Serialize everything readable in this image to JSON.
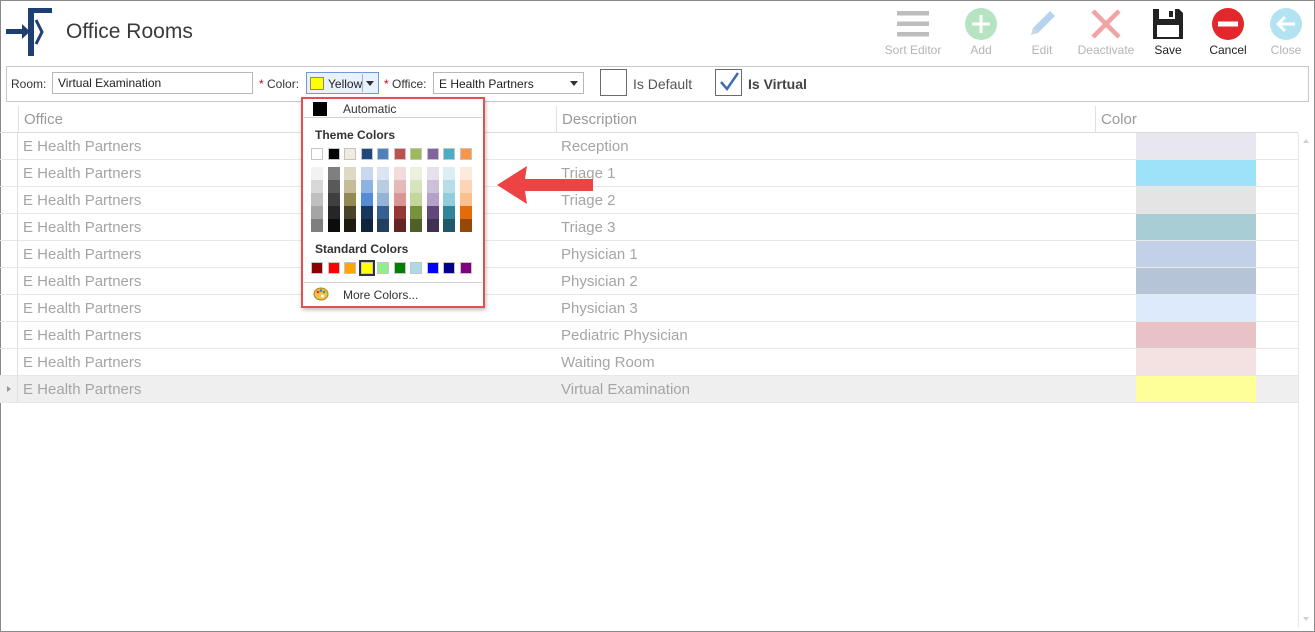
{
  "header": {
    "title": "Office Rooms"
  },
  "toolbar": {
    "sort_editor": "Sort Editor",
    "add": "Add",
    "edit": "Edit",
    "deactivate": "Deactivate",
    "save": "Save",
    "cancel": "Cancel",
    "close": "Close"
  },
  "filters": {
    "room_label": "Room:",
    "room_value": "Virtual Examination",
    "required_mark": "*",
    "color_label": "Color:",
    "color_value": "Yellow",
    "color_value_hex": "#ffff00",
    "office_label": "Office:",
    "office_value": "E Health Partners",
    "is_default_label": "Is Default",
    "is_default_checked": false,
    "is_virtual_label": "Is Virtual",
    "is_virtual_checked": true
  },
  "grid": {
    "columns": [
      "Office",
      "Description",
      "Color"
    ],
    "rows": [
      {
        "office": "E Health Partners",
        "description": "Reception",
        "color": "#e8e6ee"
      },
      {
        "office": "E Health Partners",
        "description": "Triage 1",
        "color": "#9ee2f8"
      },
      {
        "office": "E Health Partners",
        "description": "Triage 2",
        "color": "#e4e4e4"
      },
      {
        "office": "E Health Partners",
        "description": "Triage 3",
        "color": "#a9cdd5"
      },
      {
        "office": "E Health Partners",
        "description": "Physician 1",
        "color": "#c3d1e8"
      },
      {
        "office": "E Health Partners",
        "description": "Physician 2",
        "color": "#b6c4d8"
      },
      {
        "office": "E Health Partners",
        "description": "Physician 3",
        "color": "#dceafb"
      },
      {
        "office": "E Health Partners",
        "description": "Pediatric Physician",
        "color": "#e8c2c4"
      },
      {
        "office": "E Health Partners",
        "description": "Waiting Room",
        "color": "#f4e2e3"
      },
      {
        "office": "E Health Partners",
        "description": "Virtual Examination",
        "color": "#ffff99"
      }
    ],
    "current_row": 9
  },
  "color_popup": {
    "automatic_label": "Automatic",
    "theme_heading": "Theme Colors",
    "standard_heading": "Standard Colors",
    "more_label": "More Colors...",
    "theme_top": [
      "#ffffff",
      "#000000",
      "#eeece1",
      "#1f497d",
      "#4f81bd",
      "#c0504d",
      "#9bbb59",
      "#8064a2",
      "#4bacc6",
      "#f79646"
    ],
    "theme_shades": [
      [
        "#f2f2f2",
        "#d8d8d8",
        "#bfbfbf",
        "#a5a5a5",
        "#7f7f7f"
      ],
      [
        "#7f7f7f",
        "#595959",
        "#3f3f3f",
        "#262626",
        "#0c0c0c"
      ],
      [
        "#ddd9c3",
        "#c4bd97",
        "#938953",
        "#494429",
        "#1d1b10"
      ],
      [
        "#c6d9f0",
        "#8db3e2",
        "#548dd4",
        "#17365d",
        "#0f243e"
      ],
      [
        "#dbe5f1",
        "#b8cce4",
        "#95b3d7",
        "#366092",
        "#244061"
      ],
      [
        "#f2dcdb",
        "#e5b9b7",
        "#d99694",
        "#953734",
        "#632423"
      ],
      [
        "#ebf1dd",
        "#d7e3bc",
        "#c3d69b",
        "#76923c",
        "#4f6128"
      ],
      [
        "#e5e0ec",
        "#ccc1d9",
        "#b2a2c7",
        "#5f497a",
        "#3f3151"
      ],
      [
        "#dbeef3",
        "#b7dde8",
        "#92cddc",
        "#31859b",
        "#205867"
      ],
      [
        "#fdeada",
        "#fbd5b5",
        "#fac08f",
        "#e36c09",
        "#974806"
      ]
    ],
    "standard": [
      "#8b0000",
      "#ff0000",
      "#ffa500",
      "#ffff00",
      "#90ee90",
      "#008000",
      "#add8e6",
      "#0000ff",
      "#00008b",
      "#800080"
    ],
    "selected_standard": 3
  }
}
